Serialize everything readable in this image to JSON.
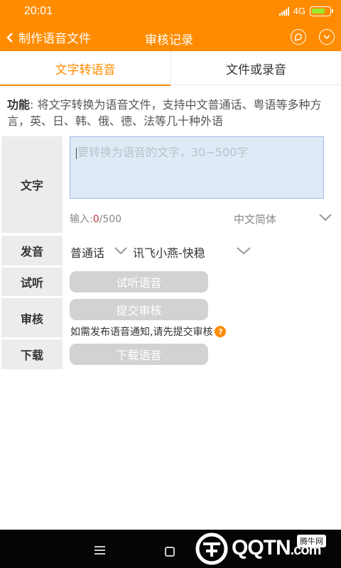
{
  "status_bar": {
    "time": "20:01",
    "network": "4G"
  },
  "header": {
    "back_label": "制作语音文件",
    "review_label": "审核记录"
  },
  "tabs": [
    {
      "label": "文字转语音",
      "active": true
    },
    {
      "label": "文件或录音",
      "active": false
    }
  ],
  "description": {
    "prefix": "功能",
    "text": ": 将文字转换为语音文件，支持中文普通话、粤语等多种方言，英、日、韩、俄、德、法等几十种外语"
  },
  "form": {
    "text_label": "文字",
    "text_placeholder": "要转换为语音的文字，30~500字",
    "count_prefix": "输入:",
    "count_value": "0",
    "count_max": "/500",
    "language": "中文简体",
    "voice_label": "发音",
    "dialect": "普通话",
    "speaker": "讯飞小燕-快稳",
    "listen_label": "试听",
    "listen_button": "试听语音",
    "review_label": "审核",
    "review_button": "提交审核",
    "review_note": "如需发布语音通知,请先提交审核",
    "download_label": "下载",
    "download_button": "下载语音"
  },
  "watermark": {
    "text": "QQTN",
    "domain": ".com",
    "badge": "腾牛网"
  },
  "colors": {
    "accent": "#ff8c00",
    "button_disabled": "#d2d2d2",
    "textarea_bg": "#dfeaf7"
  }
}
